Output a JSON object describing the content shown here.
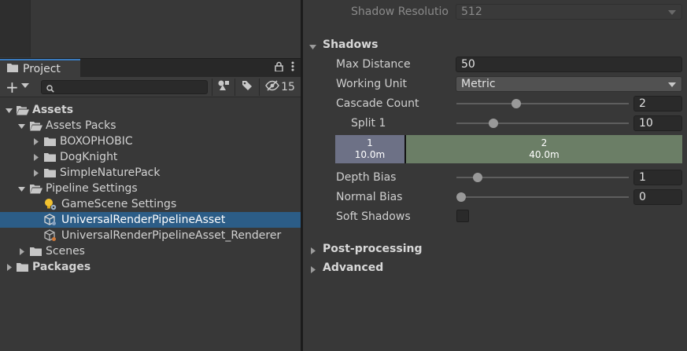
{
  "project_panel": {
    "tab_label": "Project",
    "hidden_count": "15",
    "search": {
      "value": "",
      "placeholder": ""
    },
    "tree": [
      {
        "label": "Assets",
        "bold": true,
        "expanded": true,
        "icon": "folder-open-icon"
      },
      {
        "label": "Assets Packs",
        "expanded": true,
        "icon": "folder-open-icon"
      },
      {
        "label": "BOXOPHOBIC",
        "expanded": false,
        "icon": "folder-icon"
      },
      {
        "label": "DogKnight",
        "expanded": false,
        "icon": "folder-icon"
      },
      {
        "label": "SimpleNaturePack",
        "expanded": false,
        "icon": "folder-icon"
      },
      {
        "label": "Pipeline Settings",
        "expanded": true,
        "icon": "folder-open-icon"
      },
      {
        "label": "GameScene Settings",
        "icon": "lightbulb-settings-icon"
      },
      {
        "label": "UniversalRenderPipelineAsset",
        "icon": "render-pipeline-asset-icon",
        "selected": true
      },
      {
        "label": "UniversalRenderPipelineAsset_Renderer",
        "icon": "renderer-asset-icon"
      },
      {
        "label": "Scenes",
        "expanded": false,
        "icon": "folder-icon"
      },
      {
        "label": "Packages",
        "bold": true,
        "expanded": false,
        "icon": "folder-icon"
      }
    ]
  },
  "inspector": {
    "shadow_resolution": {
      "label": "Shadow Resolutio",
      "value": "512"
    },
    "shadows_section": "Shadows",
    "max_distance": {
      "label": "Max Distance",
      "value": "50"
    },
    "working_unit": {
      "label": "Working Unit",
      "value": "Metric"
    },
    "cascade_count": {
      "label": "Cascade Count",
      "value": "2",
      "slider_fraction": 0.34
    },
    "split_1": {
      "label": "Split 1",
      "value": "10",
      "slider_fraction": 0.2
    },
    "cascades": [
      {
        "index": "1",
        "distance": "10.0m"
      },
      {
        "index": "2",
        "distance": "40.0m"
      }
    ],
    "depth_bias": {
      "label": "Depth Bias",
      "value": "1",
      "slider_fraction": 0.1
    },
    "normal_bias": {
      "label": "Normal Bias",
      "value": "0",
      "slider_fraction": 0.0
    },
    "soft_shadows": {
      "label": "Soft Shadows",
      "checked": false
    },
    "post_processing_section": "Post-processing",
    "advanced_section": "Advanced"
  },
  "colors": {
    "selection": "#2c5d87",
    "tab_accent": "#3a79bb",
    "cascade_1": "#6d7186",
    "cascade_2": "#6b7e66"
  }
}
